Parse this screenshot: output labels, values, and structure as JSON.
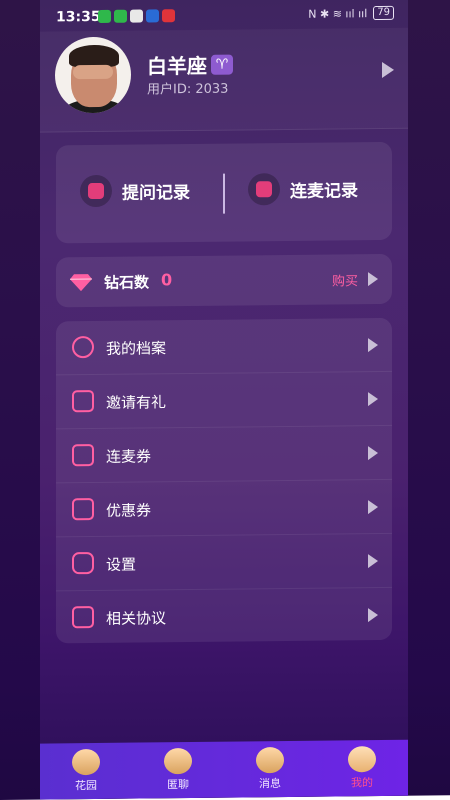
{
  "status": {
    "time": "13:35",
    "battery": "79",
    "icons_right": "N ✱ ≋ ııl ııl"
  },
  "profile": {
    "name": "白羊座",
    "zodiac_symbol": "♈",
    "user_id": "用户ID: 2033"
  },
  "records": {
    "questions": "提问记录",
    "mic": "连麦记录"
  },
  "diamond": {
    "label": "钻石数",
    "count": "0",
    "buy": "购买"
  },
  "menu": [
    {
      "label": "我的档案",
      "icon": "person-icon"
    },
    {
      "label": "邀请有礼",
      "icon": "share-icon"
    },
    {
      "label": "连麦券",
      "icon": "ticket-icon"
    },
    {
      "label": "优惠券",
      "icon": "coupon-icon"
    },
    {
      "label": "设置",
      "icon": "hexagon-settings-icon"
    },
    {
      "label": "相关协议",
      "icon": "bookmark-icon"
    }
  ],
  "nav": [
    {
      "label": "花园",
      "icon": "planet-icon"
    },
    {
      "label": "匿聊",
      "icon": "chat-person-icon"
    },
    {
      "label": "消息",
      "icon": "message-icon"
    },
    {
      "label": "我的",
      "icon": "me-icon",
      "active": true
    }
  ],
  "colors": {
    "accent": "#ff5fa2",
    "nav_bg": "#5a2fd0",
    "bg": "#3d1569"
  }
}
